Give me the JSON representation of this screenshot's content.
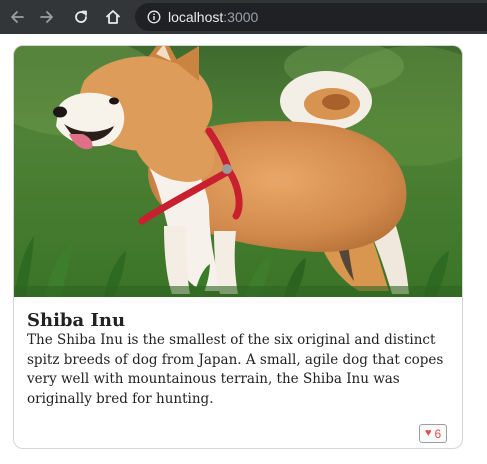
{
  "browser": {
    "url_host": "localhost",
    "url_port": ":3000",
    "icons": [
      "back-arrow-icon",
      "forward-arrow-icon",
      "reload-icon",
      "home-icon",
      "info-icon"
    ]
  },
  "card": {
    "image_subject": "shiba-inu-photo",
    "title": "Shiba Inu",
    "description": "The Shiba Inu is the smallest of the six original and distinct spitz breeds of dog from Japan. A small, agile dog that copes very well with mountainous terrain, the Shiba Inu was originally bred for hunting.",
    "likes": "6",
    "like_icon": "heart-icon"
  },
  "colors": {
    "toolbar_bg": "#323639",
    "omnibox_bg": "#202124",
    "like_color": "#d9534f"
  }
}
